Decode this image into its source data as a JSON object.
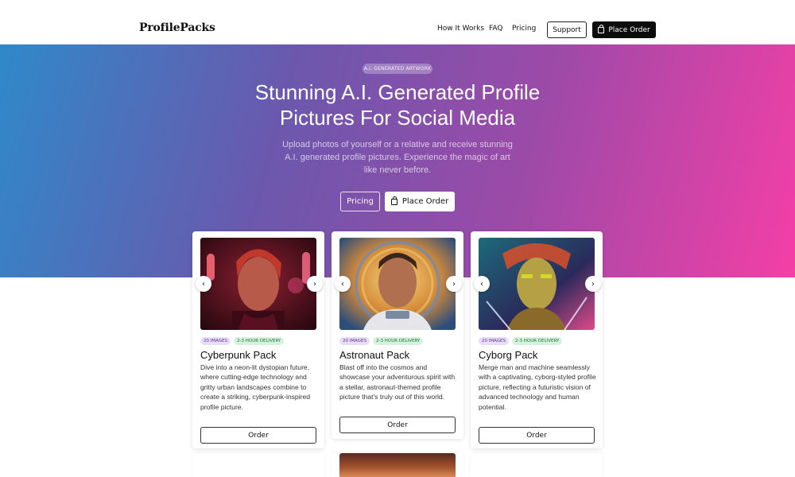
{
  "header": {
    "logo": "ProfilePacks",
    "nav": [
      "How It Works",
      "FAQ",
      "Pricing"
    ],
    "support_label": "Support",
    "place_order_label": "Place Order"
  },
  "hero": {
    "badge": "A.I. GENERATED ARTWORK",
    "title_line1": "Stunning A.I. Generated Profile",
    "title_line2": "Pictures For Social Media",
    "subtitle": "Upload photos of yourself or a relative and receive stunning A.I. generated profile pictures. Experience the magic of art like never before.",
    "pricing_label": "Pricing",
    "place_order_label": "Place Order"
  },
  "cards": [
    {
      "tag_images": "20 IMAGES",
      "tag_delivery": "2-3 HOUR DELIVERY",
      "title": "Cyberpunk Pack",
      "description": "Dive into a neon-lit dystopian future, where cutting-edge technology and gritty urban landscapes combine to create a striking, cyberpunk-inspired profile picture.",
      "order_label": "Order"
    },
    {
      "tag_images": "20 IMAGES",
      "tag_delivery": "2-3 HOUR DELIVERY",
      "title": "Astronaut Pack",
      "description": "Blast off into the cosmos and showcase your adventurous spirit with a stellar, astronaut-themed profile picture that's truly out of this world.",
      "order_label": "Order"
    },
    {
      "tag_images": "20 IMAGES",
      "tag_delivery": "2-3 HOUR DELIVERY",
      "title": "Cyborg Pack",
      "description": "Merge man and machine seamlessly with a captivating, cyborg-styled profile picture, reflecting a futuristic vision of advanced technology and human potential.",
      "order_label": "Order"
    }
  ],
  "icons": {
    "carousel_prev": "chevron-left-icon",
    "carousel_next": "chevron-right-icon",
    "bag": "shopping-bag-icon"
  },
  "colors": {
    "gradient_start": "#2f89c9",
    "gradient_end": "#f43fa6",
    "tag_purple_bg": "#e9dcfb",
    "tag_green_bg": "#d4f3dd"
  }
}
